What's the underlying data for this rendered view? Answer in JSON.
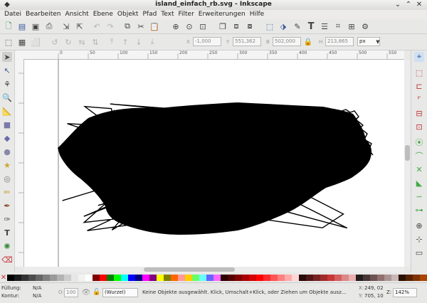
{
  "window": {
    "title": "island_einfach_rb.svg - Inkscape"
  },
  "menu": [
    "Datei",
    "Bearbeiten",
    "Ansicht",
    "Ebene",
    "Objekt",
    "Pfad",
    "Text",
    "Filter",
    "Erweiterungen",
    "Hilfe"
  ],
  "toolbar": {
    "x_label": "X",
    "x_value": "-1,000",
    "y_label": "Y",
    "y_value": "551,362",
    "w_label": "B",
    "w_value": "502,000",
    "h_label": "H",
    "h_value": "213,865",
    "unit": "px"
  },
  "ruler": {
    "h_ticks": [
      "0",
      "50",
      "100",
      "150",
      "200",
      "250",
      "300",
      "350",
      "400",
      "450",
      "500",
      "550"
    ],
    "v_ticks": [
      "1",
      "5",
      "0",
      "1",
      "0",
      "0",
      "2",
      "5",
      "0"
    ]
  },
  "palette": {
    "colors": [
      "#000000",
      "#1a1a1a",
      "#333333",
      "#4d4d4d",
      "#666666",
      "#808080",
      "#999999",
      "#b3b3b3",
      "#cccccc",
      "#e6e6e6",
      "#f2f2f2",
      "#ffffff",
      "#800000",
      "#ff0000",
      "#008000",
      "#00ff00",
      "#00ffff",
      "#0000ff",
      "#000080",
      "#ff00ff",
      "#800080",
      "#ffff00",
      "#808000",
      "#ff6600",
      "#ff9999",
      "#ffcc00",
      "#66ff66",
      "#66ffff",
      "#6666ff",
      "#ff66ff",
      "#2b0000",
      "#550000",
      "#800000",
      "#aa0000",
      "#d40000",
      "#ff0000",
      "#ff2a2a",
      "#ff5555",
      "#ff8080",
      "#ffaaaa",
      "#ffd5d5",
      "#280b0b",
      "#501616",
      "#782121",
      "#a02c2c",
      "#c83737",
      "#d35f5f",
      "#de8787",
      "#e9afaf",
      "#241c1c",
      "#483737",
      "#6c5353",
      "#916f6f",
      "#ac9393",
      "#c8b7b7",
      "#2b1100",
      "#552200",
      "#803300",
      "#aa4400",
      "#d45500",
      "#ff6600"
    ]
  },
  "status": {
    "fill_label": "Füllung:",
    "fill_value": "N/A",
    "stroke_label": "Kontur:",
    "stroke_value": "N/A",
    "opacity_label": "O:",
    "opacity_value": "100",
    "layer": "(Wurzel)",
    "message": "Keine Objekte ausgewählt. Klick, Umschalt+Klick, oder Ziehen um Objekte ausz…",
    "x_label": "X:",
    "x_coord": "249, 02",
    "y_label": "Y:",
    "y_coord": "705, 10",
    "zoom_label": "Z:",
    "zoom": "142%"
  }
}
